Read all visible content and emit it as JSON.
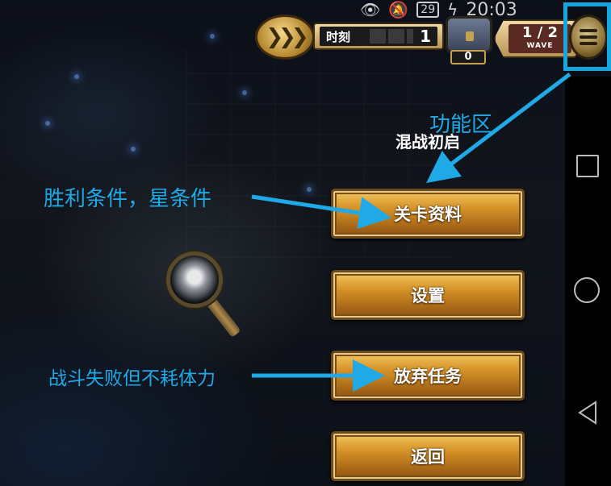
{
  "status_bar": {
    "battery": "29",
    "time": "20:03"
  },
  "hud": {
    "speed_icon": "fast-forward-icon",
    "timer_label": "时刻",
    "timer_value": "1",
    "chest_count": "0",
    "wave_value": "1 / 2",
    "wave_label": "WAVE",
    "menu_icon": "menu-icon"
  },
  "menu": {
    "title": "混战初启",
    "buttons": {
      "info": "关卡资料",
      "settings": "设置",
      "abandon": "放弃任务",
      "back": "返回"
    }
  },
  "annotations": {
    "function_area": "功能区",
    "victory_conditions": "胜利条件，星条件",
    "fail_no_stamina": "战斗失败但不耗体力",
    "color": "#1fa9e6"
  },
  "nav_bar": {
    "icons": [
      "recent-apps-icon",
      "home-icon",
      "back-icon"
    ]
  }
}
